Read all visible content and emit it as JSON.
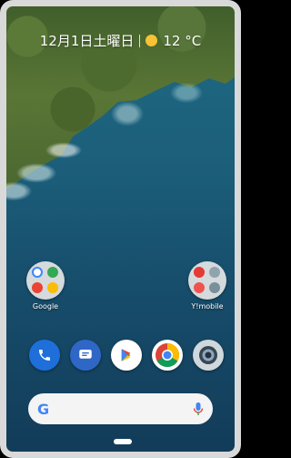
{
  "header": {
    "date_text": "12月1日土曜日",
    "weather_temp": "12 °C"
  },
  "folders": [
    {
      "label": "Google"
    },
    {
      "label": "Y!mobile"
    }
  ],
  "dock": [
    {
      "icon": "phone-icon"
    },
    {
      "icon": "messages-icon"
    },
    {
      "icon": "play-store-icon"
    },
    {
      "icon": "chrome-icon"
    },
    {
      "icon": "camera-icon"
    }
  ],
  "search": {
    "logo": "G"
  },
  "colors": {
    "weather_sun": "#f7c236",
    "google_blue": "#4285f4",
    "search_bg": "#f4f4f4"
  }
}
